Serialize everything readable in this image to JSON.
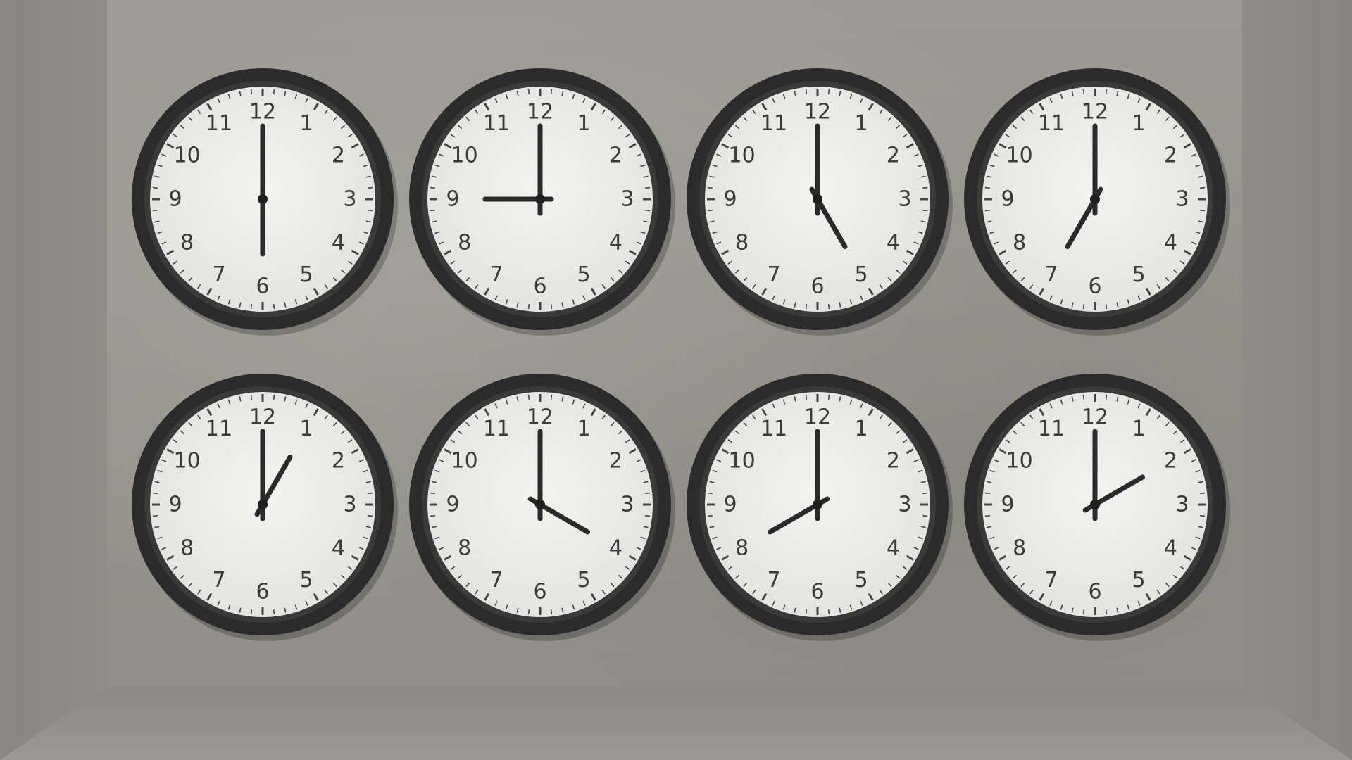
{
  "numerals": [
    "12",
    "1",
    "2",
    "3",
    "4",
    "5",
    "6",
    "7",
    "8",
    "9",
    "10",
    "11"
  ],
  "clocks": [
    {
      "hour": 6,
      "minute": 0
    },
    {
      "hour": 9,
      "minute": 0
    },
    {
      "hour": 5,
      "minute": 0
    },
    {
      "hour": 7,
      "minute": 0
    },
    {
      "hour": 1,
      "minute": 0
    },
    {
      "hour": 4,
      "minute": 0
    },
    {
      "hour": 8,
      "minute": 0
    },
    {
      "hour": 2,
      "minute": 0
    }
  ],
  "colors": {
    "wall": "#96968d",
    "clock_frame": "#2b2b2b",
    "clock_face": "#ededea",
    "hands": "#2a2a2a",
    "numerals": "#3a3a3a"
  }
}
